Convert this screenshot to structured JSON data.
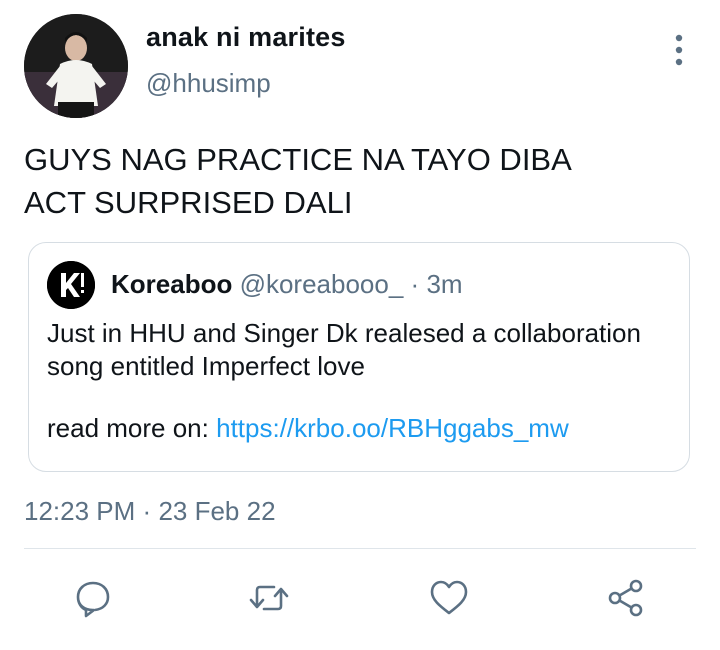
{
  "tweet": {
    "author": {
      "name": "anak ni marites",
      "handle": "@hhusimp"
    },
    "text": "GUYS NAG PRACTICE NA TAYO DIBA\nACT SURPRISED DALI",
    "quote": {
      "name": "Koreaboo",
      "handle": "@koreabooo_",
      "separator": "·",
      "time": "3m",
      "text": "Just in HHU and Singer Dk realesed a collaboration song entitled Imperfect love",
      "read_more_label": "read more on:",
      "link": "https://krbo.oo/RBHggabs_mw"
    },
    "time": "12:23 PM",
    "date_separator": "·",
    "date": "23 Feb 22"
  },
  "actions": {
    "reply_icon": "comment-icon",
    "retweet_icon": "retweet-icon",
    "like_icon": "heart-icon",
    "share_icon": "share-icon"
  },
  "colors": {
    "text": "#0f1419",
    "secondary": "#5b7083",
    "link": "#1d9bf0",
    "border": "#d6dde3"
  }
}
